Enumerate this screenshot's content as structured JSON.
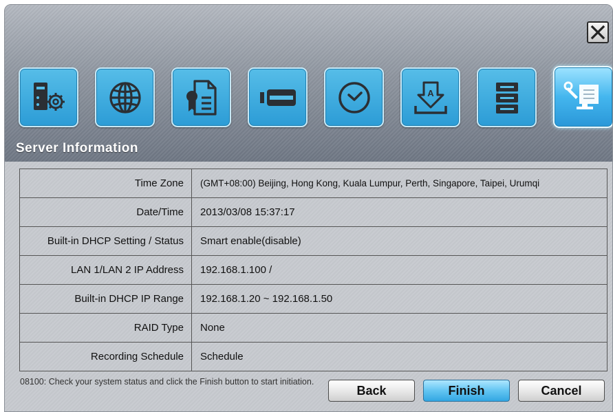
{
  "title": "Server Information",
  "steps": [
    {
      "icon": "server-settings-icon"
    },
    {
      "icon": "globe-icon"
    },
    {
      "icon": "certificate-icon"
    },
    {
      "icon": "storage-card-icon"
    },
    {
      "icon": "clock-icon"
    },
    {
      "icon": "download-icon"
    },
    {
      "icon": "storage-stack-icon"
    },
    {
      "icon": "tools-icon"
    }
  ],
  "active_step": 7,
  "rows": [
    {
      "label": "Time Zone",
      "value": "(GMT+08:00) Beijing, Hong Kong, Kuala Lumpur, Perth, Singapore, Taipei, Urumqi"
    },
    {
      "label": "Date/Time",
      "value": "2013/03/08 15:37:17"
    },
    {
      "label": "Built-in DHCP Setting / Status",
      "value": "Smart enable(disable)"
    },
    {
      "label": "LAN 1/LAN 2 IP Address",
      "value": "192.168.1.100 /"
    },
    {
      "label": "Built-in DHCP IP Range",
      "value": "192.168.1.20 ~ 192.168.1.50"
    },
    {
      "label": "RAID Type",
      "value": "None"
    },
    {
      "label": "Recording Schedule",
      "value": "Schedule"
    }
  ],
  "status_message": "08100: Check your system status and click the Finish button to start initiation.",
  "buttons": {
    "back": "Back",
    "finish": "Finish",
    "cancel": "Cancel"
  }
}
